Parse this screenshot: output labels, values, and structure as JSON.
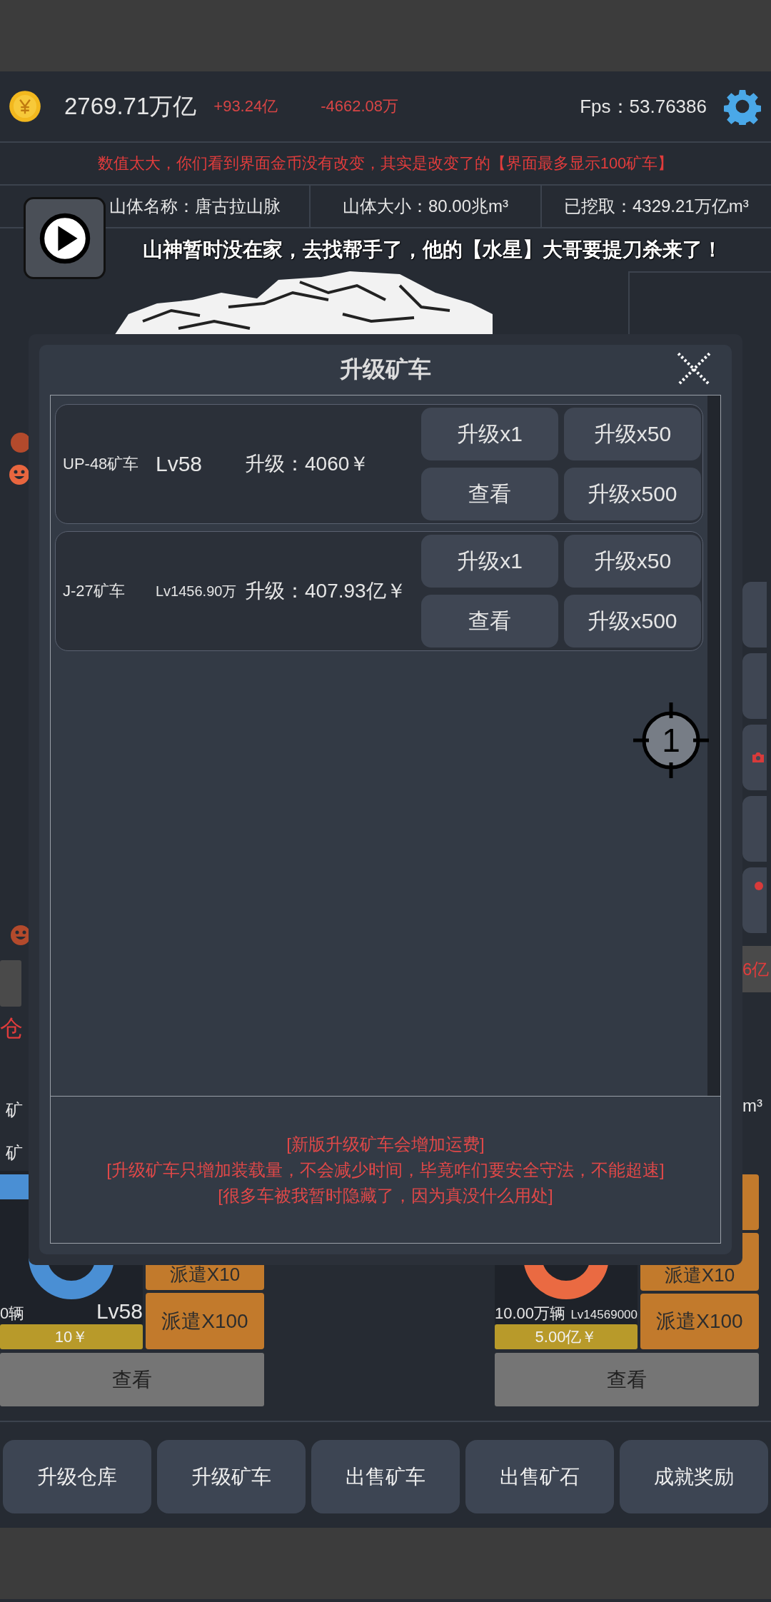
{
  "header": {
    "coins": "2769.71万亿",
    "gain": "+93.24亿",
    "loss": "-4662.08万",
    "fps": "Fps：53.76386"
  },
  "notice": "数值太大，你们看到界面金币没有改变，其实是改变了的【界面最多显示100矿车】",
  "mountain_info": [
    "山体名称：唐古拉山脉",
    "山体大小：80.00兆m³",
    "已挖取：4329.21万亿m³"
  ],
  "banner": "山神暂时没在家，去找帮手了，他的【水星】大哥要提刀杀来了！",
  "side_left": {
    "warehouse": "仓",
    "rows": [
      "矿",
      "矿"
    ]
  },
  "side_right": {
    "amount": "6亿",
    "unit": "m³"
  },
  "trucks": [
    {
      "count": "0辆",
      "level": "Lv58",
      "price": "10￥",
      "dispatch": [
        "派遣X10",
        "派遣X100"
      ],
      "view": "查看",
      "color": "#4a8fd4"
    },
    {
      "count": "10.00万辆",
      "level": "Lv14569000",
      "price": "5.00亿￥",
      "dispatch": [
        "派遣X10",
        "派遣X100"
      ],
      "view": "查看",
      "color": "#ea6a42"
    }
  ],
  "dialog": {
    "title": "升级矿车",
    "items": [
      {
        "name": "UP-48矿车",
        "level": "Lv58",
        "cost": "升级：4060￥",
        "buttons": [
          "升级x1",
          "升级x50",
          "查看",
          "升级x500"
        ]
      },
      {
        "name": "J-27矿车",
        "level": "Lv1456.90万",
        "cost": "升级：407.93亿￥",
        "buttons": [
          "升级x1",
          "升级x50",
          "查看",
          "升级x500"
        ]
      }
    ],
    "notes": [
      "[新版升级矿车会增加运费]",
      "[升级矿车只增加装载量，不会减少时间，毕竟咋们要安全守法，不能超速]",
      "[很多车被我暂时隐藏了，因为真没什么用处]"
    ]
  },
  "pointer": {
    "label": "1"
  },
  "nav": [
    "升级仓库",
    "升级矿车",
    "出售矿车",
    "出售矿石",
    "成就奖励"
  ]
}
